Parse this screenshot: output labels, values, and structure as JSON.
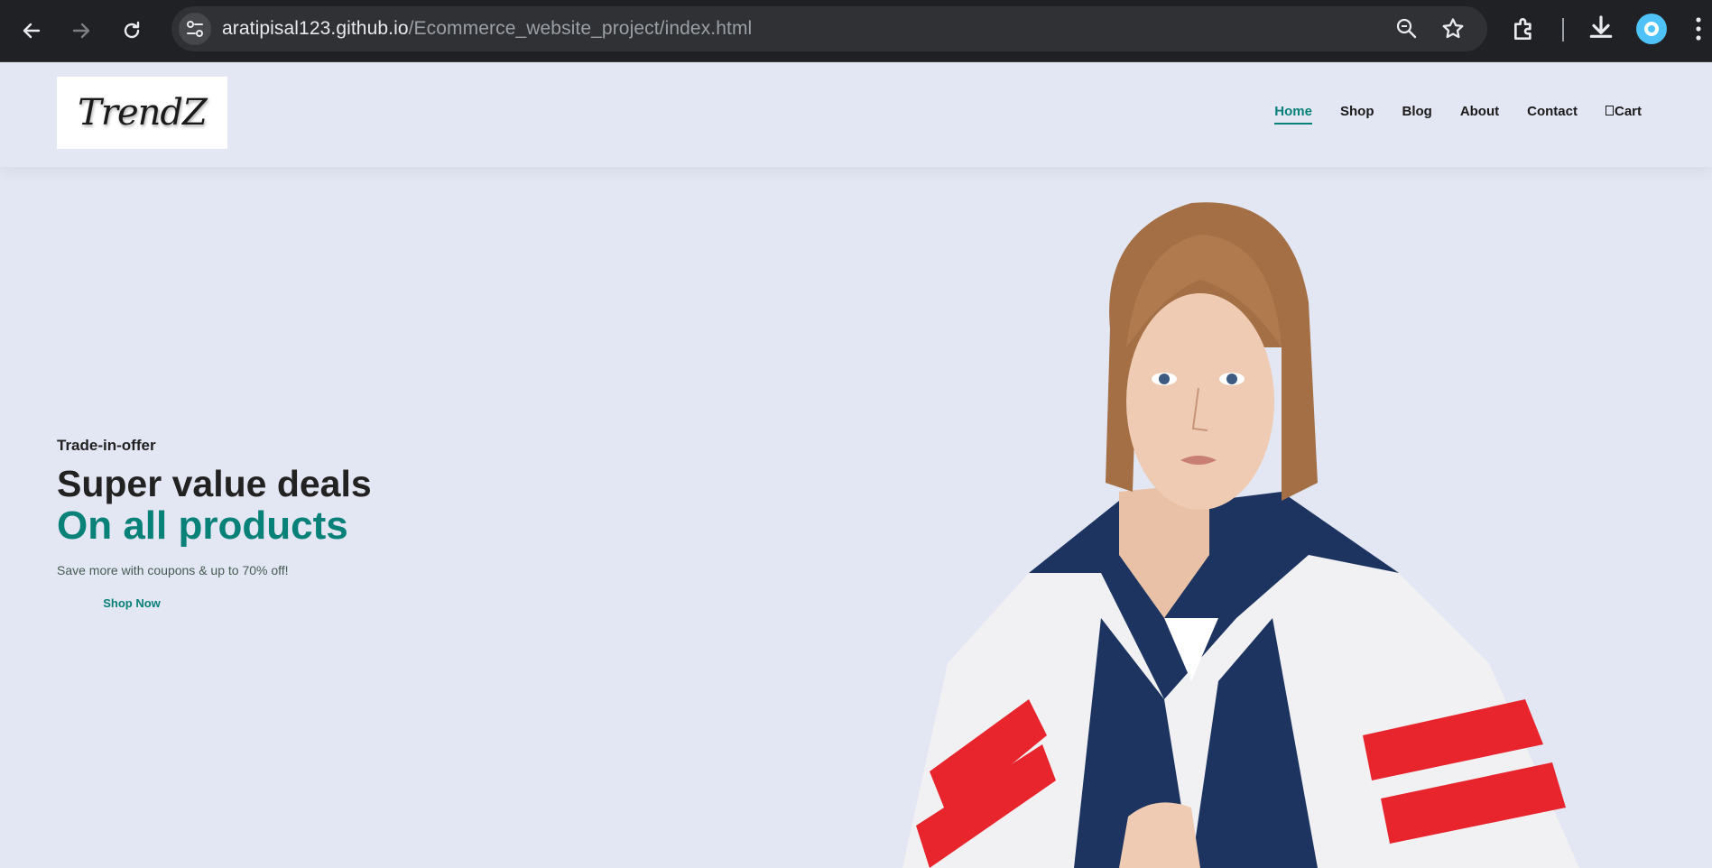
{
  "browser": {
    "url_host": "aratipisal123.github.io",
    "url_path": "/Ecommerce_website_project/index.html",
    "icons": [
      "back-arrow-icon",
      "forward-arrow-icon",
      "reload-icon",
      "site-settings-icon",
      "zoom-icon",
      "bookmark-star-icon",
      "extensions-icon",
      "download-icon",
      "profile-avatar-icon",
      "more-menu-icon"
    ]
  },
  "site": {
    "logo_text": "TrendZ",
    "nav": {
      "home": "Home",
      "shop": "Shop",
      "blog": "Blog",
      "about": "About",
      "contact": "Contact",
      "cart": "Cart"
    },
    "accent_color": "#088178",
    "background_color": "#e3e6f3"
  },
  "hero": {
    "kicker": "Trade-in-offer",
    "headline": "Super value deals",
    "headline_accent": "On all products",
    "subtext": "Save more with coupons & up to 70% off!",
    "cta": "Shop Now",
    "image": "model-in-track-jacket"
  }
}
